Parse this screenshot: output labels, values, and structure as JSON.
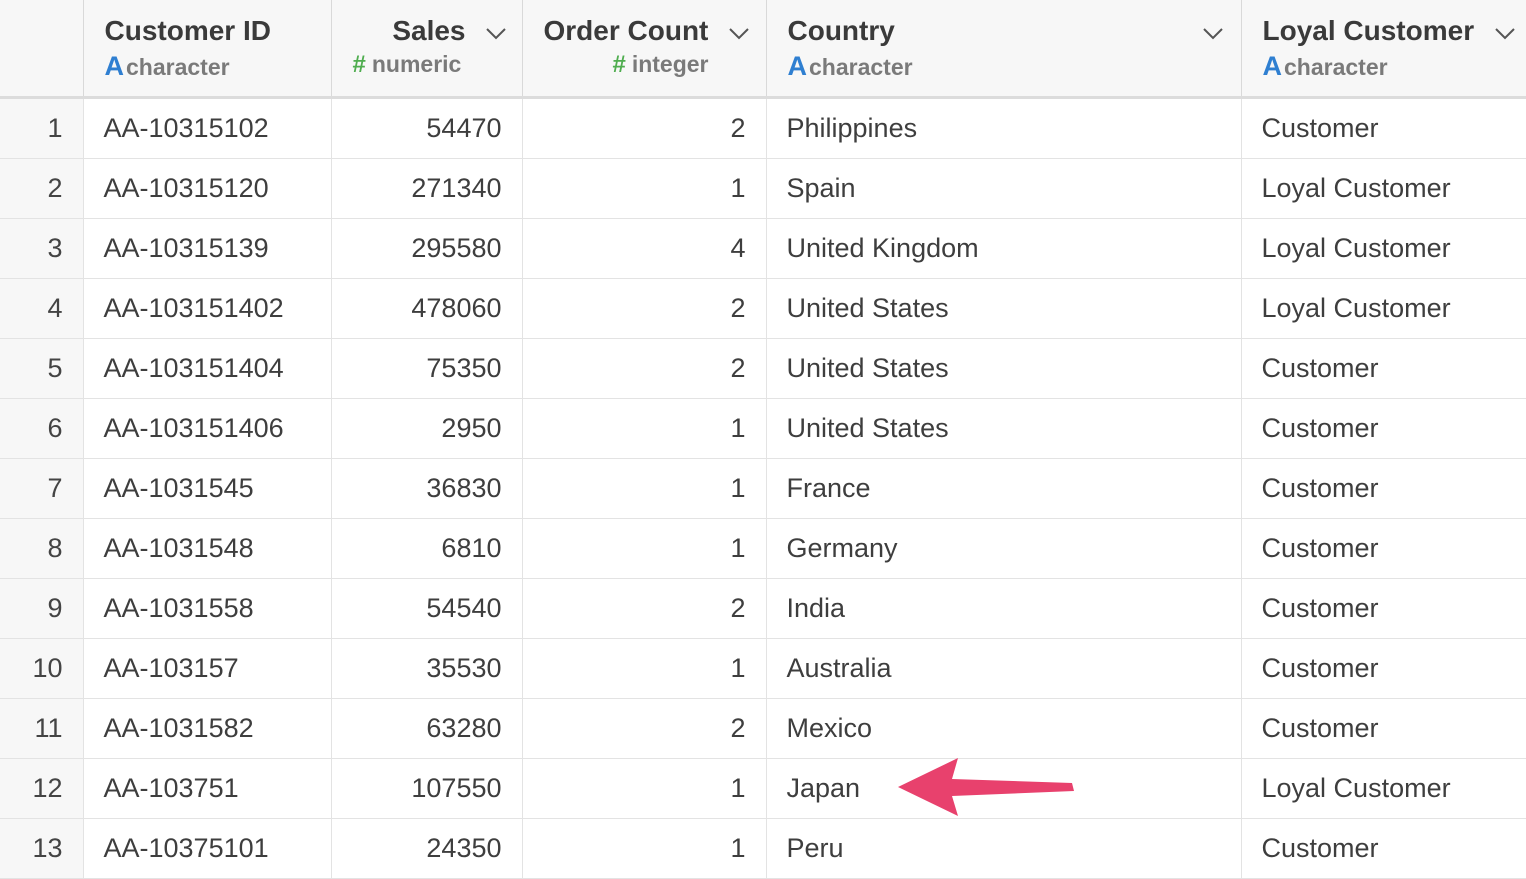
{
  "columns": [
    {
      "name": "Customer ID",
      "type": "character",
      "type_icon": "A"
    },
    {
      "name": "Sales",
      "type": "numeric",
      "type_icon": "#"
    },
    {
      "name": "Order Count",
      "type": "integer",
      "type_icon": "#"
    },
    {
      "name": "Country",
      "type": "character",
      "type_icon": "A"
    },
    {
      "name": "Loyal Customer",
      "type": "character",
      "type_icon": "A"
    }
  ],
  "rows": [
    {
      "idx": "1",
      "id": "AA-10315102",
      "sales": "54470",
      "count": "2",
      "country": "Philippines",
      "loyal": "Customer"
    },
    {
      "idx": "2",
      "id": "AA-10315120",
      "sales": "271340",
      "count": "1",
      "country": "Spain",
      "loyal": "Loyal Customer"
    },
    {
      "idx": "3",
      "id": "AA-10315139",
      "sales": "295580",
      "count": "4",
      "country": "United Kingdom",
      "loyal": "Loyal Customer"
    },
    {
      "idx": "4",
      "id": "AA-103151402",
      "sales": "478060",
      "count": "2",
      "country": "United States",
      "loyal": "Loyal Customer"
    },
    {
      "idx": "5",
      "id": "AA-103151404",
      "sales": "75350",
      "count": "2",
      "country": "United States",
      "loyal": "Customer"
    },
    {
      "idx": "6",
      "id": "AA-103151406",
      "sales": "2950",
      "count": "1",
      "country": "United States",
      "loyal": "Customer"
    },
    {
      "idx": "7",
      "id": "AA-1031545",
      "sales": "36830",
      "count": "1",
      "country": "France",
      "loyal": "Customer"
    },
    {
      "idx": "8",
      "id": "AA-1031548",
      "sales": "6810",
      "count": "1",
      "country": "Germany",
      "loyal": "Customer"
    },
    {
      "idx": "9",
      "id": "AA-1031558",
      "sales": "54540",
      "count": "2",
      "country": "India",
      "loyal": "Customer"
    },
    {
      "idx": "10",
      "id": "AA-103157",
      "sales": "35530",
      "count": "1",
      "country": "Australia",
      "loyal": "Customer"
    },
    {
      "idx": "11",
      "id": "AA-1031582",
      "sales": "63280",
      "count": "2",
      "country": "Mexico",
      "loyal": "Customer"
    },
    {
      "idx": "12",
      "id": "AA-103751",
      "sales": "107550",
      "count": "1",
      "country": "Japan",
      "loyal": "Loyal Customer"
    },
    {
      "idx": "13",
      "id": "AA-10375101",
      "sales": "24350",
      "count": "1",
      "country": "Peru",
      "loyal": "Customer"
    }
  ],
  "colors": {
    "character_icon": "#2f7fd1",
    "numeric_icon": "#4fad4f",
    "annotation_arrow": "#e8416d"
  }
}
